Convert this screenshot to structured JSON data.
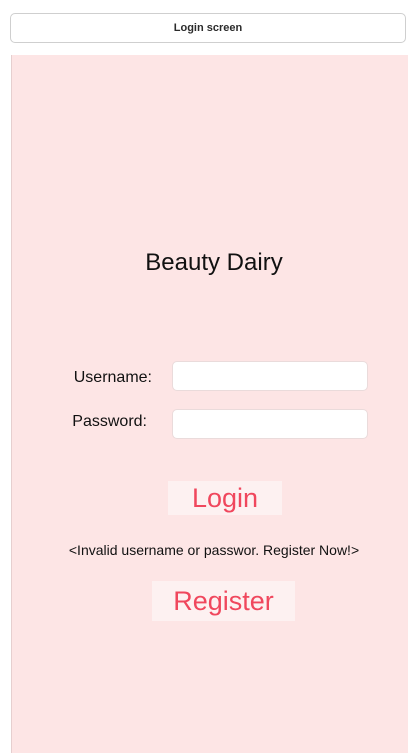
{
  "window": {
    "title": "Login screen"
  },
  "app": {
    "title": "Beauty Dairy"
  },
  "form": {
    "username_label": "Username:",
    "username_value": "",
    "password_label": "Password:",
    "password_value": "",
    "login_label": "Login",
    "error_message": "<Invalid username or passwor. Register Now!>",
    "register_label": "Register"
  },
  "colors": {
    "background": "#fde5e5",
    "button_background": "#fdf1f1",
    "button_text": "#f0475d"
  }
}
